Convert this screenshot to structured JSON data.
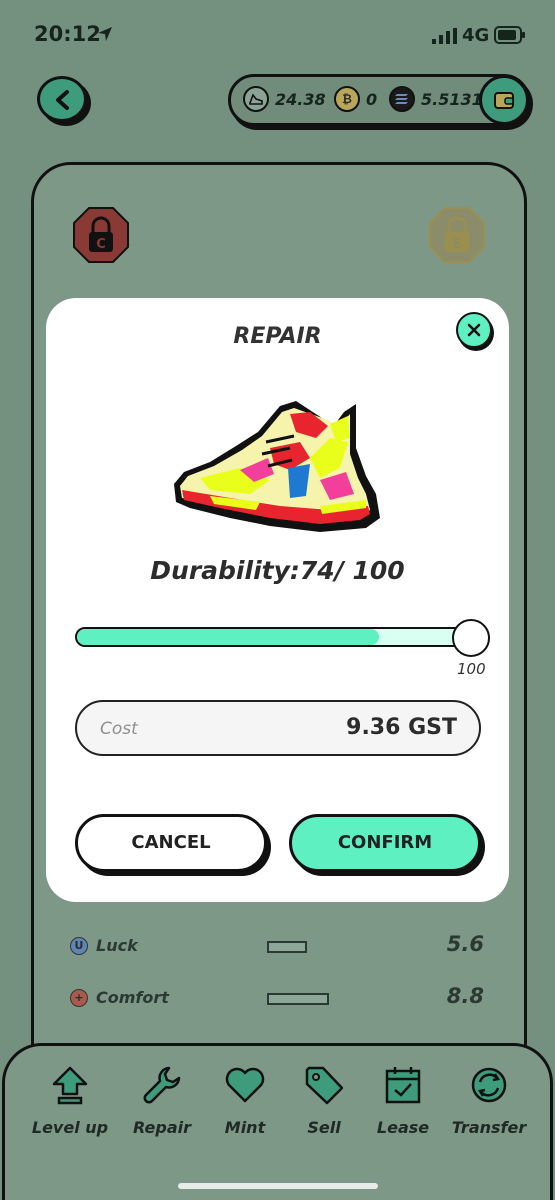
{
  "status": {
    "time": "20:12",
    "network": "4G"
  },
  "balances": [
    {
      "icon": "gst-coin-icon",
      "value": "24.38"
    },
    {
      "icon": "gmt-coin-icon",
      "value": "0"
    },
    {
      "icon": "sol-coin-icon",
      "value": "5.5131"
    }
  ],
  "card": {
    "lock_c_label": "C",
    "lock_e_label": "E",
    "attributes": [
      {
        "icon_text": "U",
        "label": "Luck",
        "value": "5.6",
        "color": "#4a7ec4"
      },
      {
        "icon_text": "+",
        "label": "Comfort",
        "value": "8.8",
        "color": "#c0392b"
      }
    ]
  },
  "modal": {
    "title": "REPAIR",
    "durability": "Durability:74/ 100",
    "durability_current": 74,
    "durability_max": 100,
    "slider_max_label": "100",
    "cost_label": "Cost",
    "cost_value": "9.36 GST",
    "cancel_label": "CANCEL",
    "confirm_label": "CONFIRM"
  },
  "nav": [
    {
      "label": "Level up",
      "icon": "level-up-icon"
    },
    {
      "label": "Repair",
      "icon": "wrench-icon"
    },
    {
      "label": "Mint",
      "icon": "heart-icon"
    },
    {
      "label": "Sell",
      "icon": "tag-icon"
    },
    {
      "label": "Lease",
      "icon": "calendar-icon"
    },
    {
      "label": "Transfer",
      "icon": "transfer-icon"
    }
  ],
  "colors": {
    "accent": "#5ff0c2",
    "overlay": "#74917f",
    "dark_accent": "#3e9c7d"
  }
}
